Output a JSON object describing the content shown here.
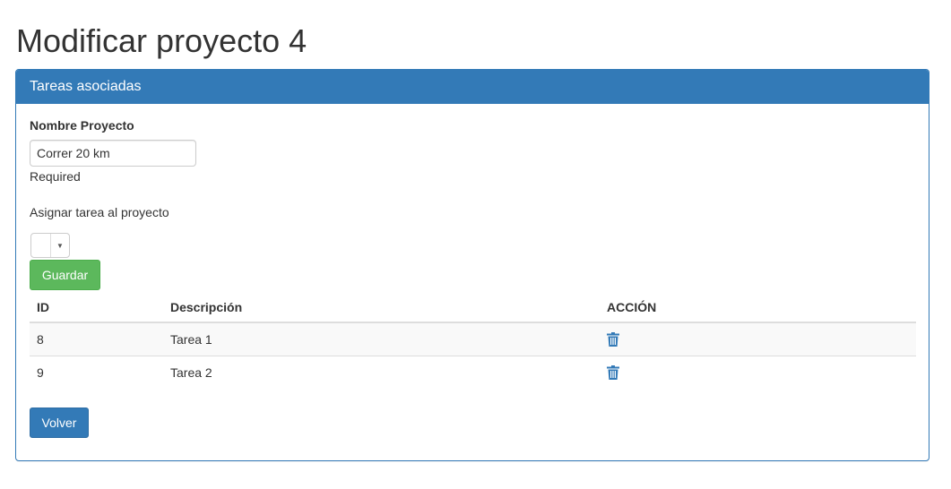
{
  "page": {
    "title": "Modificar proyecto 4"
  },
  "panel": {
    "heading": "Tareas asociadas",
    "name_label": "Nombre Proyecto",
    "name_value": "Correr 20 km",
    "name_help": "Required",
    "assign_label": "Asignar tarea al proyecto",
    "assign_selected": "",
    "save_label": "Guardar",
    "back_label": "Volver"
  },
  "table": {
    "headers": {
      "id": "ID",
      "description": "Descripción",
      "action": "ACCIÓN"
    },
    "rows": [
      {
        "id": "8",
        "description": "Tarea 1",
        "action_icon": "trash-icon"
      },
      {
        "id": "9",
        "description": "Tarea 2",
        "action_icon": "trash-icon"
      }
    ]
  },
  "colors": {
    "primary": "#337ab7",
    "success": "#5cb85c",
    "text": "#333333"
  }
}
